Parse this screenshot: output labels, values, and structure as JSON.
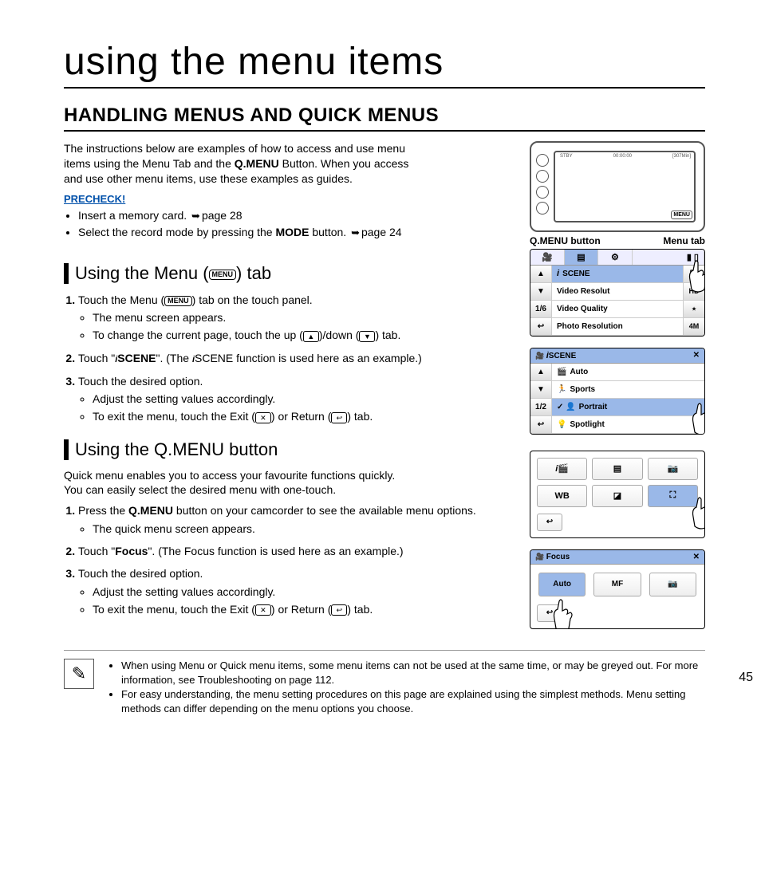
{
  "page_number": "45",
  "title": "using the menu items",
  "section": "HANDLING MENUS AND QUICK MENUS",
  "intro_l1": "The instructions below are examples of how to access and use menu",
  "intro_l2_a": "items using the Menu Tab and the ",
  "intro_l2_b": "Q.MENU",
  "intro_l2_c": " Button. When you access",
  "intro_l3": "and use other menu items, use these examples as guides.",
  "precheck": "PRECHECK!",
  "pre1_a": "Insert a memory card. ",
  "pre1_b": "page 28",
  "pre2_a": "Select the record mode by pressing the ",
  "pre2_b": "MODE",
  "pre2_c": " button. ",
  "pre2_d": "page 24",
  "cam_label_left": "Q.MENU button",
  "cam_label_right": "Menu tab",
  "cam_menu_chip": "MENU",
  "cam_top": {
    "a": "STBY",
    "b": "00:00:00",
    "c": "[307Min]"
  },
  "sub1_a": "Using the Menu (",
  "sub1_b": ") tab",
  "menu_chip": "MENU",
  "s1_1a": "Touch the Menu (",
  "s1_1b": ") tab on the touch panel.",
  "s1_1_b1": "The menu screen appears.",
  "s1_1_b2a": "To change the current page, touch the up (",
  "s1_1_b2b": ")/down (",
  "s1_1_b2c": ") tab.",
  "s1_2a": "Touch \"",
  "s1_2b": "SCENE",
  "s1_2c": "\". (The ",
  "s1_2d": "SCENE function is used here as an example.)",
  "s1_3": "Touch the desired option.",
  "s1_3_b1": "Adjust the setting values accordingly.",
  "s1_3_b2a": "To exit the menu, touch the Exit (",
  "s1_3_b2b": ") or Return (",
  "s1_3_b2c": ") tab.",
  "sub2": "Using the Q.MENU button",
  "q_intro1": "Quick menu enables you to access your favourite functions quickly.",
  "q_intro2": "You can easily select the desired menu with one-touch.",
  "q1_a": "Press the ",
  "q1_b": "Q.MENU",
  "q1_c": " button on your camcorder to see the available menu options.",
  "q1_b1": "The quick menu screen appears.",
  "q2_a": "Touch \"",
  "q2_b": "Focus",
  "q2_c": "\". (The Focus function is used here as an example.)",
  "q3": "Touch the desired option.",
  "q3_b1": "Adjust the setting values accordingly.",
  "q3_b2a": "To exit the menu, touch the Exit (",
  "q3_b2b": ") or Return (",
  "q3_b2c": ") tab.",
  "note1": "When using Menu or Quick menu items, some menu items can not be used at the same time, or may be greyed out. For more information, see Troubleshooting on page 112.",
  "note2": "For easy understanding, the menu setting procedures on this page are explained using the simplest methods. Menu setting methods can differ depending on the menu options you choose.",
  "menuscreen1": {
    "side": {
      "up": "▲",
      "down": "▼",
      "page": "1/6",
      "ret": "↩"
    },
    "rows": [
      "SCENE",
      "Video Resolut",
      "Video Quality",
      "Photo Resolution"
    ],
    "right": [
      "▶",
      "▶",
      "▶",
      "▶"
    ]
  },
  "menuscreen2": {
    "title": "SCENE",
    "close": "✕",
    "side": {
      "up": "▲",
      "down": "▼",
      "page": "1/2",
      "ret": "↩"
    },
    "rows": [
      "Auto",
      "Sports",
      "Portrait",
      "Spotlight"
    ],
    "sel_index": 2
  },
  "focusscreen": {
    "title": "Focus",
    "close": "✕",
    "opts": [
      "Auto",
      "MF",
      "📷"
    ],
    "ret": "↩"
  },
  "icons": {
    "up": "▲",
    "down": "▼",
    "exit": "✕",
    "return": "↩",
    "iscene": "i"
  }
}
